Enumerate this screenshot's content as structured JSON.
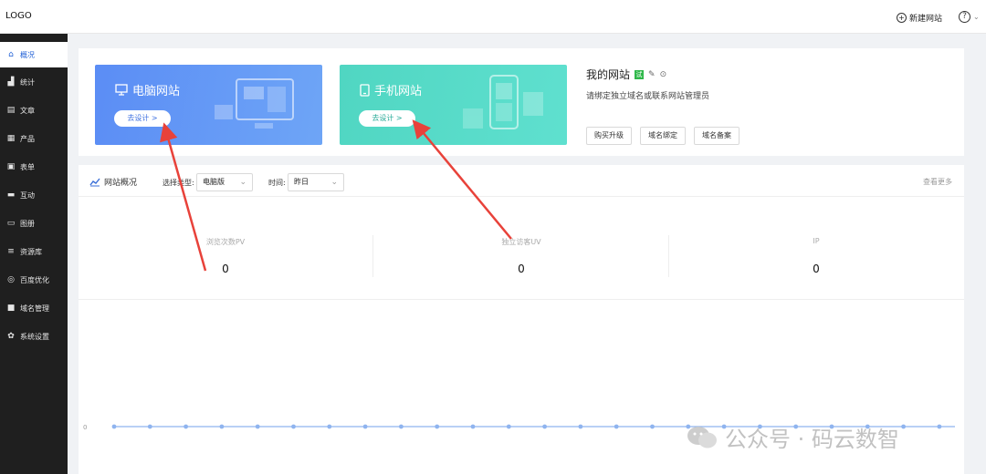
{
  "topbar": {
    "logo": "LOGO",
    "new_site_label": "新建网站",
    "new_site_icon": "plus-circle-icon",
    "help_icon": "question-circle-icon"
  },
  "sidebar": {
    "items": [
      {
        "label": "概况",
        "icon": "home-icon",
        "active": true
      },
      {
        "label": "统计",
        "icon": "chart-icon"
      },
      {
        "label": "文章",
        "icon": "document-icon"
      },
      {
        "label": "产品",
        "icon": "grid-icon"
      },
      {
        "label": "表单",
        "icon": "form-icon"
      },
      {
        "label": "互动",
        "icon": "chat-icon"
      },
      {
        "label": "图册",
        "icon": "album-icon"
      },
      {
        "label": "资源库",
        "icon": "database-icon"
      },
      {
        "label": "百度优化",
        "icon": "seo-icon"
      },
      {
        "label": "域名管理",
        "icon": "domain-icon"
      },
      {
        "label": "系统设置",
        "icon": "settings-icon"
      }
    ]
  },
  "cards": {
    "pc": {
      "title": "电脑网站",
      "button": "去设计 >",
      "color": "#5b8df5"
    },
    "mobile": {
      "title": "手机网站",
      "button": "去设计 >",
      "color": "#50d6c2"
    }
  },
  "site": {
    "title": "我的网站",
    "trial_badge": "试",
    "hint": "请绑定独立域名或联系网站管理员",
    "actions": [
      "购买升级",
      "域名绑定",
      "域名备案"
    ]
  },
  "overview": {
    "title": "网站概况",
    "type_label": "选择类型:",
    "type_value": "电脑版",
    "time_label": "时间:",
    "time_value": "昨日",
    "more_link": "查看更多",
    "stats": [
      {
        "label": "浏览次数PV",
        "value": "0"
      },
      {
        "label": "独立访客UV",
        "value": "0"
      },
      {
        "label": "IP",
        "value": "0"
      }
    ],
    "chart_y_label": "0",
    "point_count": 24,
    "line_color": "#8fb4ef"
  },
  "watermark": "公众号 · 码云数智",
  "colors": {
    "accent": "#1f5fd6",
    "sidebar_bg": "#1f1f1f",
    "annotation": "#e8423a"
  }
}
